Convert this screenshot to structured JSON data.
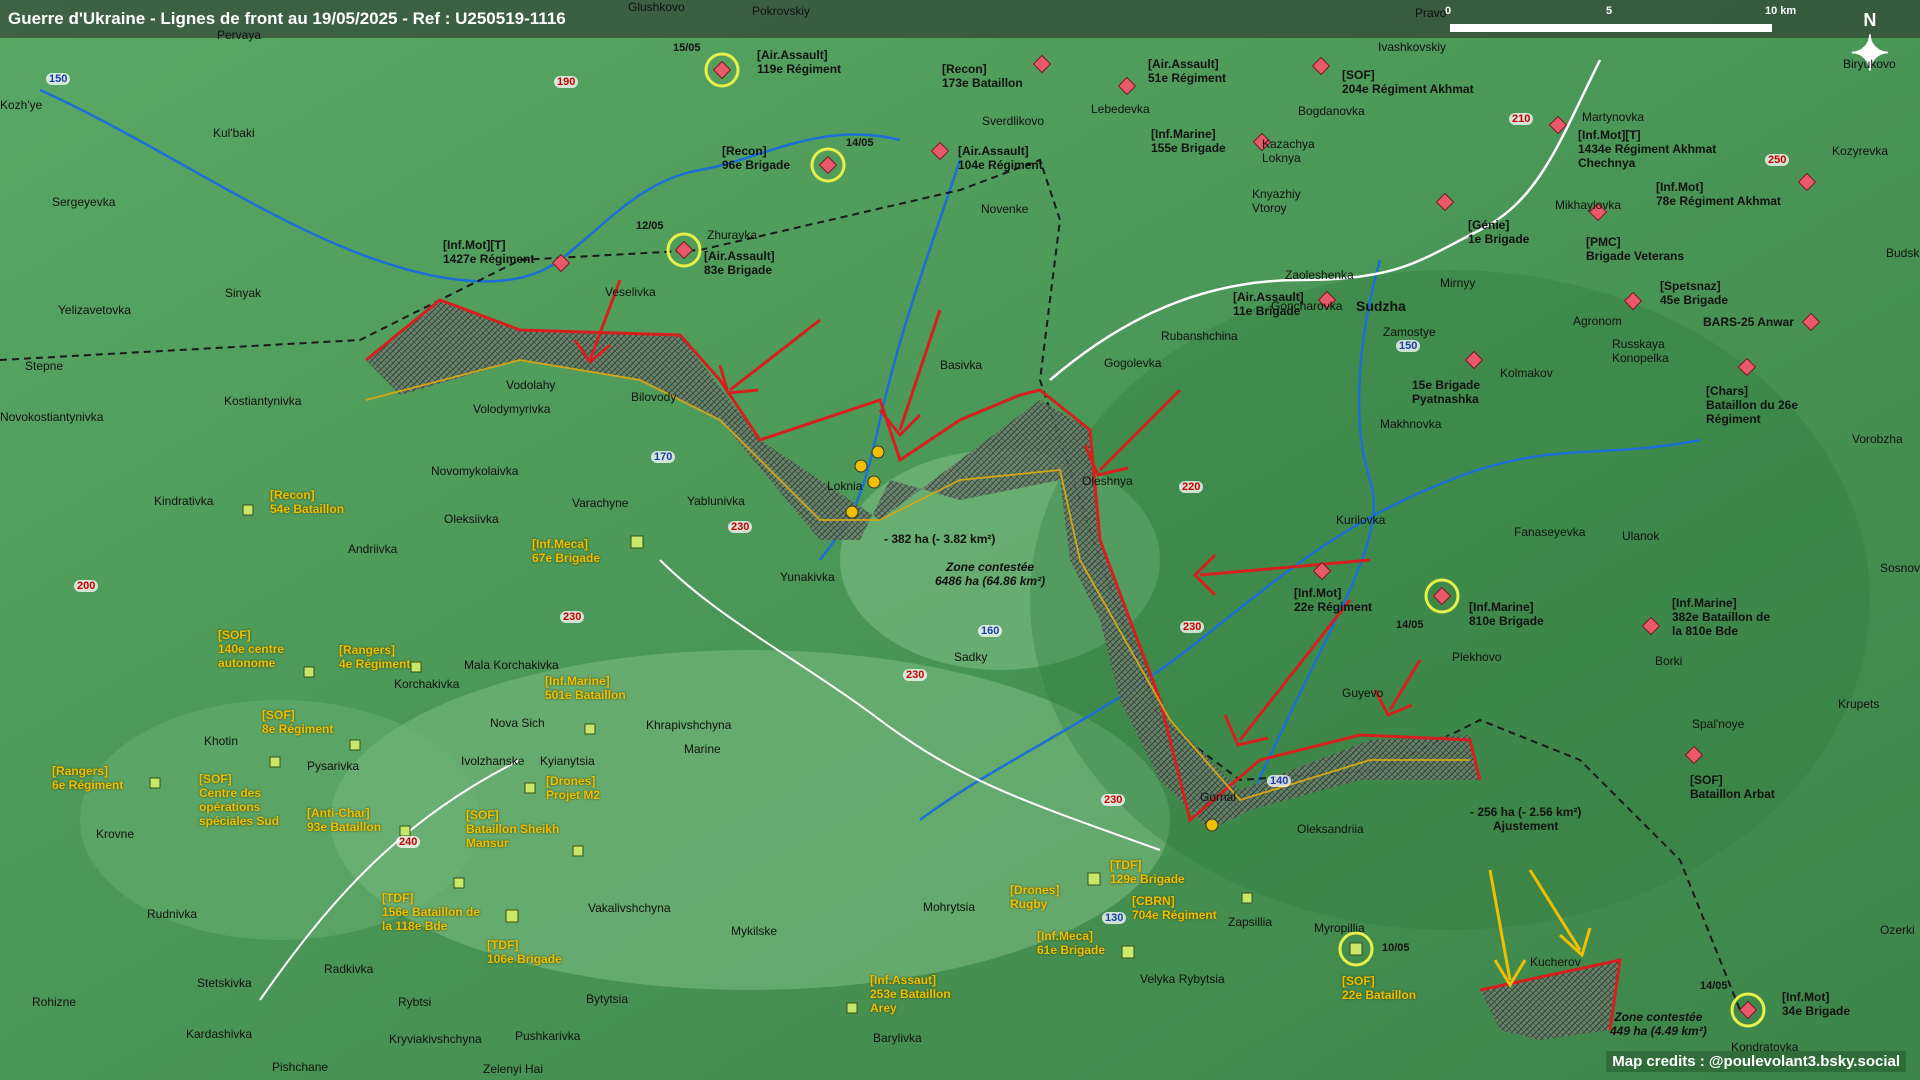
{
  "title": "Guerre d'Ukraine - Lignes de front au 19/05/2025 - Ref : U250519-1116",
  "scale": {
    "zero": "0",
    "mid": "5",
    "end": "10 km"
  },
  "north_label": "N",
  "credits": "Map credits : @poulevolant3.bsky.social",
  "zones": [
    {
      "title": "Zone contestée",
      "area": "6486 ha (64.86 km²)"
    },
    {
      "title": "Zone contestée",
      "area": "449 ha (4.49 km²)"
    }
  ],
  "deltas": [
    {
      "text": "- 382 ha (- 3.82 km²)"
    },
    {
      "text": "- 256 ha (- 2.56 km²)",
      "note": "Ajustement"
    }
  ],
  "dates": [
    "15/05",
    "14/05",
    "12/05",
    "14/05",
    "10/05",
    "14/05"
  ],
  "russian_units": [
    {
      "type": "[Air.Assault]",
      "name": "119e Régiment"
    },
    {
      "type": "[Recon]",
      "name": "173e Bataillon"
    },
    {
      "type": "[Air.Assault]",
      "name": "51e Régiment"
    },
    {
      "type": "[SOF]",
      "name": "204e Régiment Akhmat"
    },
    {
      "type": "[Recon]",
      "name": "96e Brigade"
    },
    {
      "type": "[Air.Assault]",
      "name": "104e Régiment"
    },
    {
      "type": "[Inf.Marine]",
      "name": "155e Brigade"
    },
    {
      "type": "[Inf.Mot][T]",
      "name": "1434e Régiment Akhmat Chechnya"
    },
    {
      "type": "[Inf.Mot]",
      "name": "78e Régiment Akhmat"
    },
    {
      "type": "[Air.Assault]",
      "name": "83e Brigade"
    },
    {
      "type": "[Inf.Mot][T]",
      "name": "1427e Régiment"
    },
    {
      "type": "[Génie]",
      "name": "1e Brigade"
    },
    {
      "type": "[PMC]",
      "name": "Brigade Veterans"
    },
    {
      "type": "[Air.Assault]",
      "name": "11e Brigade"
    },
    {
      "type": "[Spetsnaz]",
      "name": "45e Brigade"
    },
    {
      "type": "",
      "name": "BARS-25 Anwar"
    },
    {
      "type": "",
      "name": "15e Brigade Pyatnashka"
    },
    {
      "type": "[Chars]",
      "name": "Bataillon du 26e Régiment"
    },
    {
      "type": "[Inf.Mot]",
      "name": "22e Régiment"
    },
    {
      "type": "[Inf.Marine]",
      "name": "810e Brigade"
    },
    {
      "type": "[Inf.Marine]",
      "name": "382e Bataillon de la 810e Bde"
    },
    {
      "type": "[SOF]",
      "name": "Bataillon Arbat"
    },
    {
      "type": "[Inf.Mot]",
      "name": "34e Brigade"
    }
  ],
  "ukrainian_units": [
    {
      "type": "[Recon]",
      "name": "54e Bataillon"
    },
    {
      "type": "[Inf.Meca]",
      "name": "67e Brigade"
    },
    {
      "type": "[SOF]",
      "name": "140e centre autonome"
    },
    {
      "type": "[Rangers]",
      "name": "4e Régiment"
    },
    {
      "type": "[Inf.Marine]",
      "name": "501e Bataillon"
    },
    {
      "type": "[SOF]",
      "name": "8e Régiment"
    },
    {
      "type": "[Rangers]",
      "name": "6e Régiment"
    },
    {
      "type": "[SOF]",
      "name": "Centre des opérations spéciales Sud"
    },
    {
      "type": "[Drones]",
      "name": "Projet M2"
    },
    {
      "type": "[Anti-Char]",
      "name": "93e Bataillon"
    },
    {
      "type": "[SOF]",
      "name": "Bataillon Sheikh Mansur"
    },
    {
      "type": "[TDF]",
      "name": "156e Bataillon de la 118e Bde"
    },
    {
      "type": "[TDF]",
      "name": "106e Brigade"
    },
    {
      "type": "[Drones]",
      "name": "Rugby"
    },
    {
      "type": "[TDF]",
      "name": "129e Brigade"
    },
    {
      "type": "[CBRN]",
      "name": "704e Régiment"
    },
    {
      "type": "[Inf.Meca]",
      "name": "61e Brigade"
    },
    {
      "type": "[Inf.Assaut]",
      "name": "253e Bataillon Arey"
    },
    {
      "type": "[SOF]",
      "name": "22e Bataillon"
    }
  ],
  "places": [
    "Glushkovo",
    "Pokrovskiy",
    "Pervaya",
    "Kul'baki",
    "Sergeyevka",
    "Yelizavetovka",
    "Sinyak",
    "Stepne",
    "Kostiantynivka",
    "Novokostiantynivka",
    "Veselivka",
    "Zhuravka",
    "Vodolahy",
    "Bilovody",
    "Volodymyrivka",
    "Novomykolaivka",
    "Kindrativka",
    "Oleksiivka",
    "Andriivka",
    "Varachyne",
    "Yablunivka",
    "Loknia",
    "Yunakivka",
    "Sverdlikovo",
    "Lebedevka",
    "Novenke",
    "Basivka",
    "Gogolevka",
    "Oleshnya",
    "Rubanshchina",
    "Zaoleshenka",
    "Goncharovka",
    "Sudzha",
    "Zamostye",
    "Mirnyy",
    "Bogdanovka",
    "Kazachya Loknya",
    "Knyazhiy Vtoroy",
    "Ivashkovskiy",
    "Pravo",
    "Martynovka",
    "Mikhaylovka",
    "Agronom",
    "Russkaya Konopelka",
    "Kolmakov",
    "Makhnovka",
    "Kurilovka",
    "Fanaseyevka",
    "Ulanok",
    "Plekhovo",
    "Guyevo",
    "Gornal",
    "Oleksandriia",
    "Zapsillia",
    "Myropillia",
    "Mohrytsia",
    "Mykilske",
    "Velyka Rybytsia",
    "Barylivka",
    "Mala Korchakivka",
    "Korchakivka",
    "Nova Sich",
    "Khrapivshchyna",
    "Kyianytsia",
    "Ivolzhanske",
    "Pysarivka",
    "Khotin",
    "Krovne",
    "Rudnivka",
    "Stetskivka",
    "Radkivka",
    "Rybtsi",
    "Kardashivka",
    "Rohizne",
    "Pushkarivka",
    "Bytytsia",
    "Vakalivshchyna",
    "Sadky",
    "Marine",
    "Kryviakivshchyna",
    "Pishchane",
    "Zelenyi Hai",
    "Kucherov",
    "Kondratovka",
    "Spal'noye",
    "Krupets",
    "Borki",
    "Vorobzha",
    "Sosnovyi",
    "Biryukovo",
    "Kozyrevka",
    "Budsk",
    "Ozerki",
    "Kozh'ye"
  ],
  "roads": [
    "150",
    "190",
    "210",
    "250",
    "170",
    "230",
    "220",
    "200",
    "230",
    "160",
    "230",
    "240",
    "140",
    "130",
    "230",
    "150",
    "230"
  ],
  "colors": {
    "front": "#d61f1f",
    "ua_unit": "#f0c000",
    "ru_marker": "#e85a6a",
    "terrain": "#4e9b57"
  }
}
